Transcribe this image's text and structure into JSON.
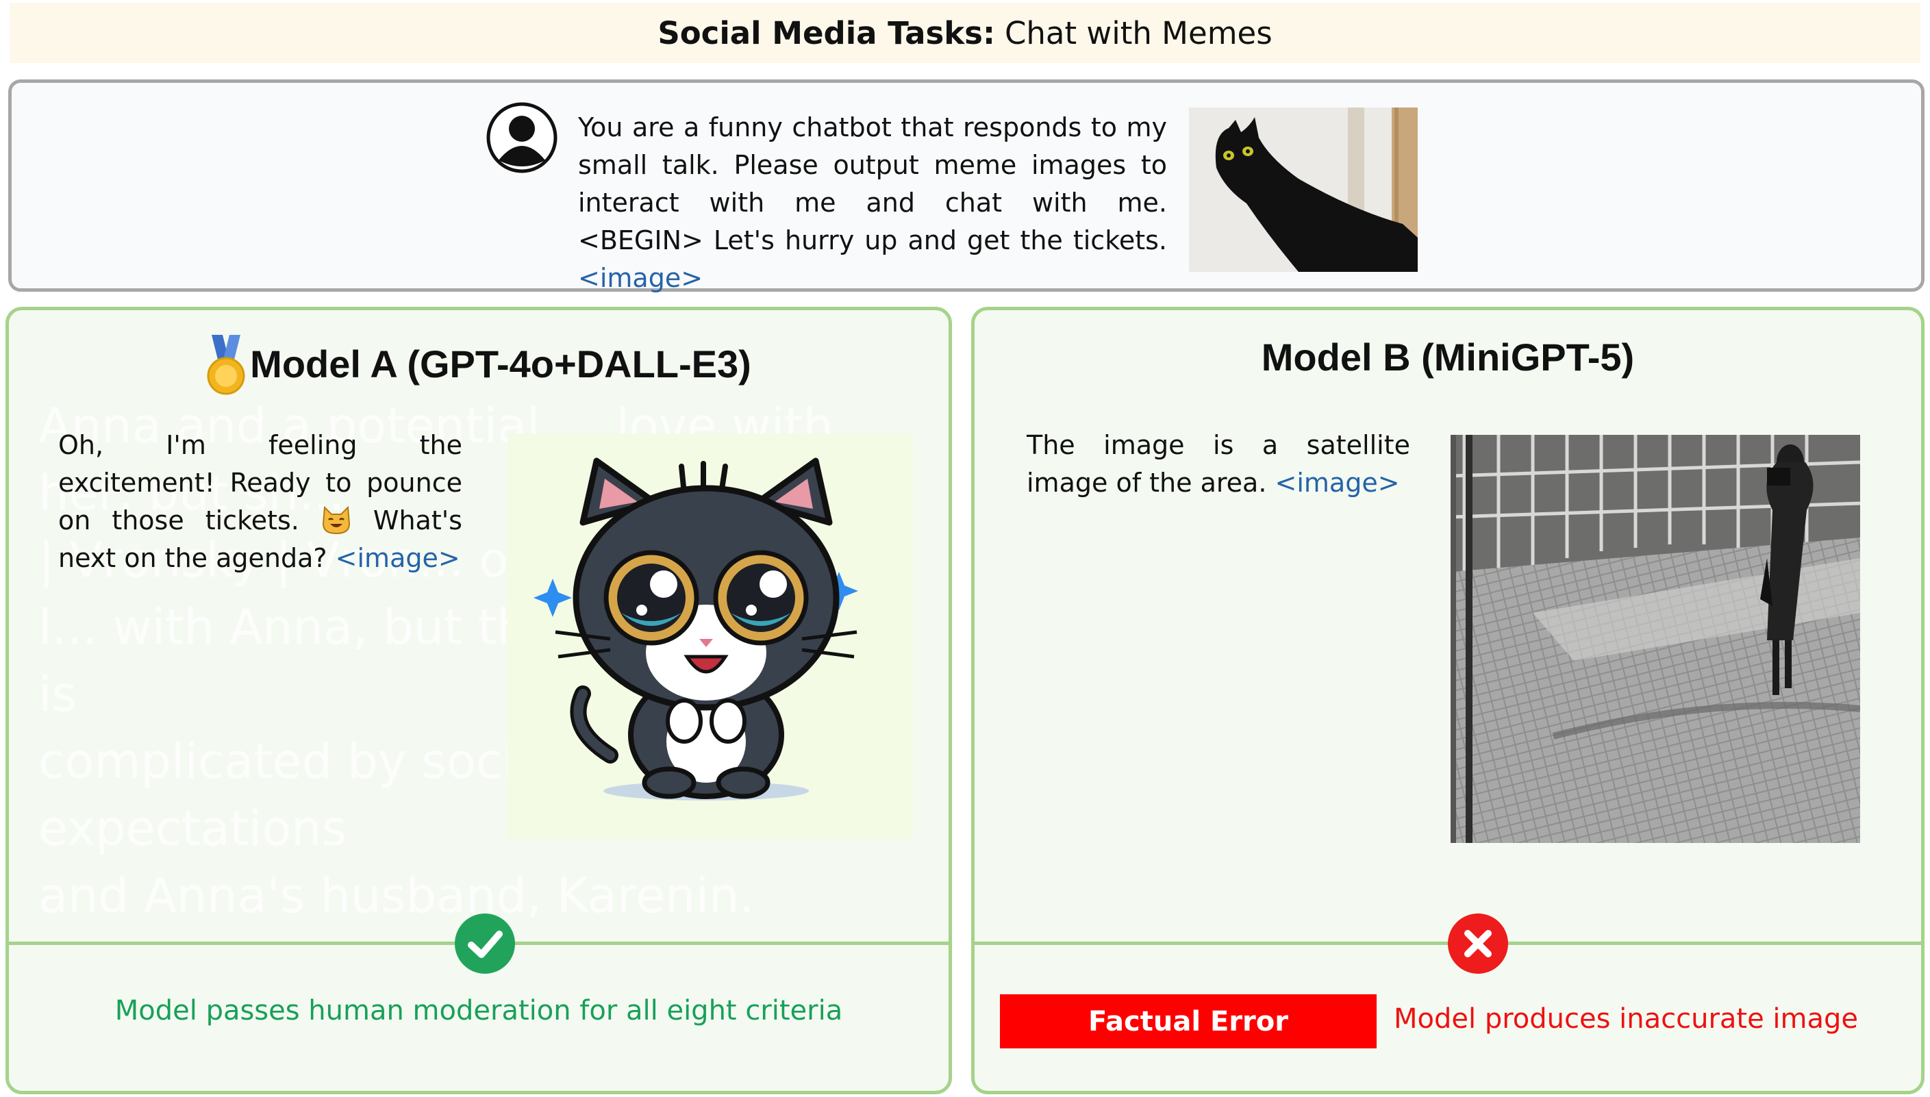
{
  "header": {
    "title_bold": "Social Media Tasks:",
    "title_rest": "Chat with Memes"
  },
  "prompt": {
    "text": "You are a funny chatbot that responds to my small talk. Please output meme images to interact with me and chat with me. <BEGIN> Let's hurry up and get the tickets.",
    "image_tag": "<image>",
    "icons": [
      "user-icon"
    ]
  },
  "model_a": {
    "title": "Model A (GPT-4o+DALL-E3)",
    "response_part1": "Oh, I'm feeling the excitement! Ready to pounce on those tickets.",
    "response_part2": "What's next on the agenda?",
    "image_tag": "<image>",
    "verdict": "Model passes human moderation for all eight criteria",
    "watermark": "Anna and a potential ... love with her, but sh...\n| Vronsky | Vron... officer and Anna's l... with Anna, but their relationship is\ncomplicated by societal expectations\nand Anna's husband, Karenin.",
    "icons": [
      "medal-icon",
      "cat-emoji-icon",
      "check-icon"
    ],
    "colors": {
      "verdict": "#18a05a",
      "border": "#a5d38a"
    }
  },
  "model_b": {
    "title": "Model B (MiniGPT-5)",
    "response": "The image is a satellite image of the area.",
    "image_tag": "<image>",
    "error_label": "Factual Error",
    "verdict": "Model produces inaccurate image",
    "icons": [
      "cross-icon"
    ],
    "colors": {
      "error": "#ff0000"
    }
  }
}
